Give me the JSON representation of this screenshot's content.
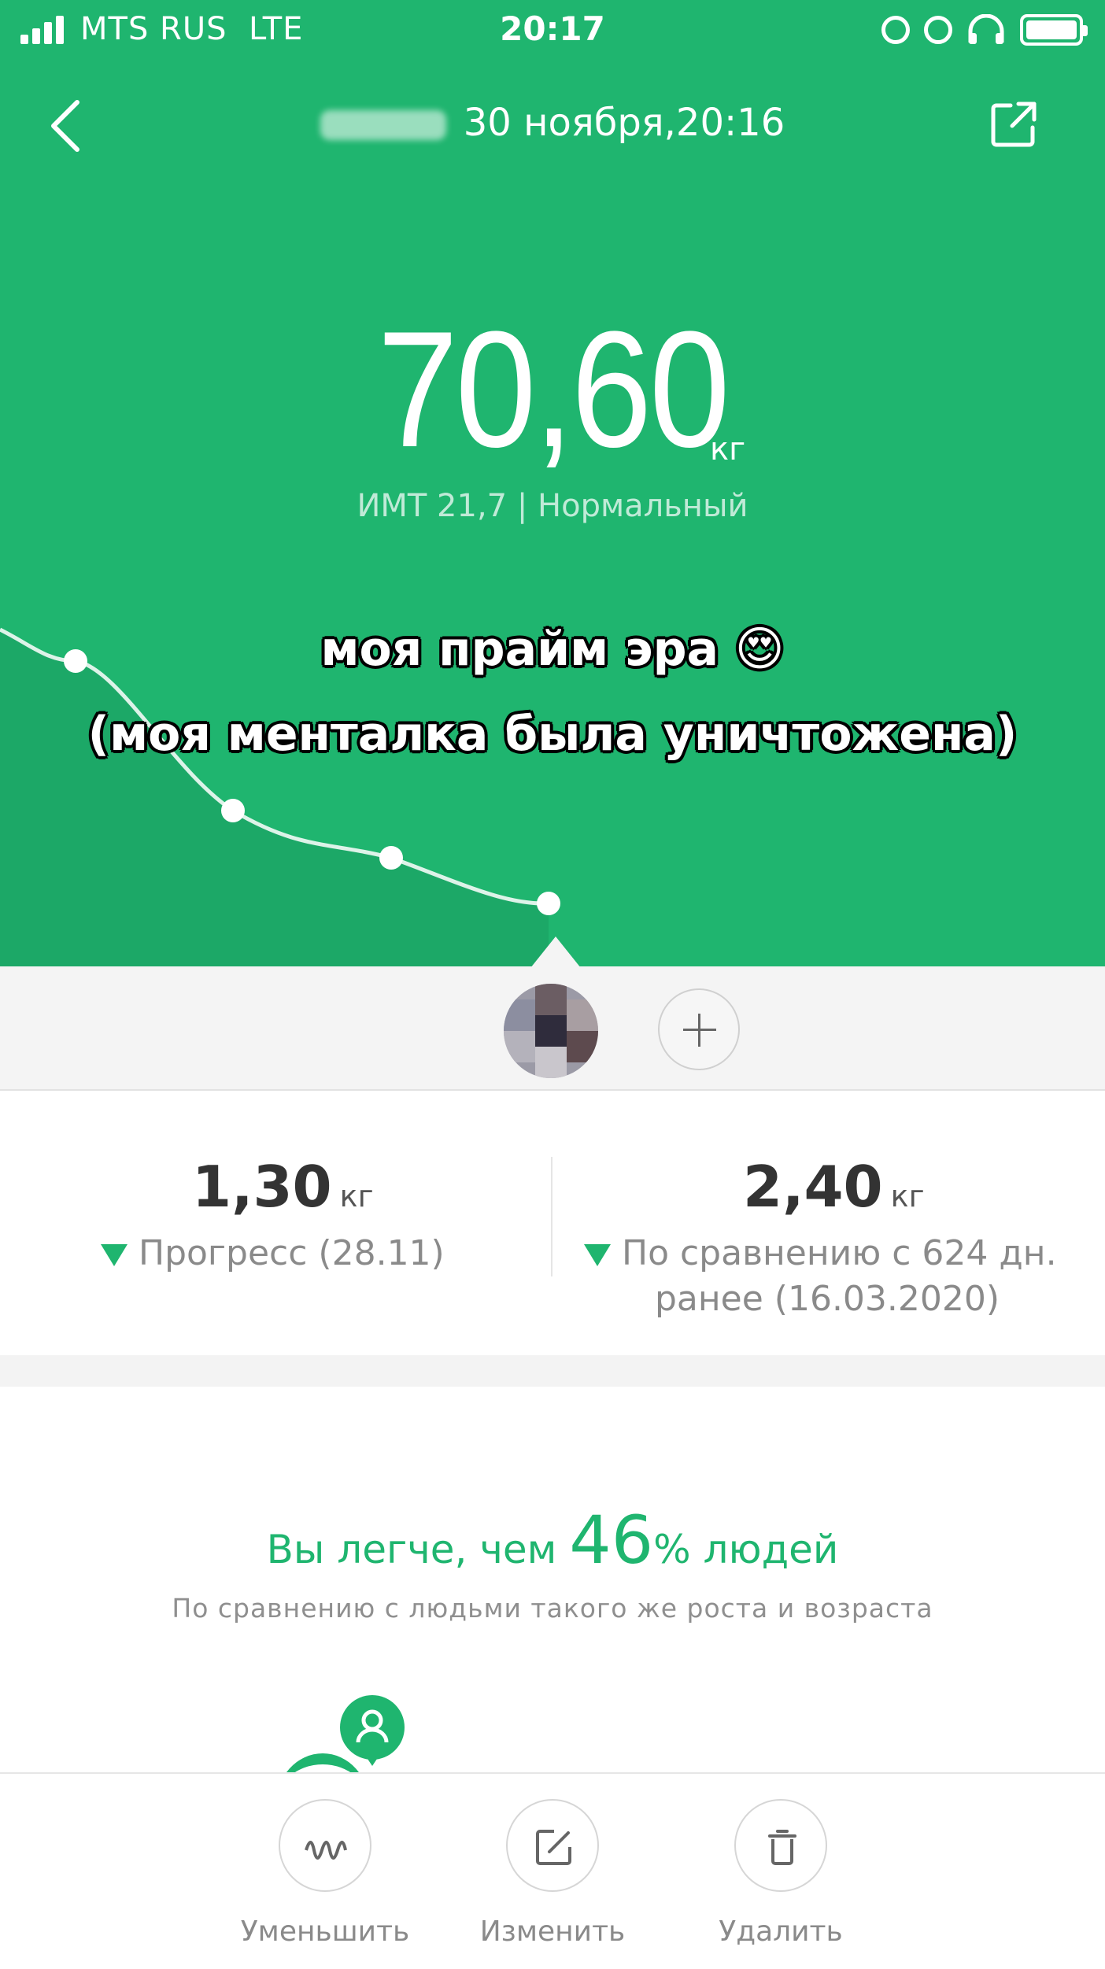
{
  "status_bar": {
    "carrier": "MTS RUS",
    "network": "LTE",
    "time": "20:17"
  },
  "header": {
    "title": "30 ноября,20:16"
  },
  "measurement": {
    "weight": "70,60",
    "unit": "кг",
    "bmi": "ИМТ 21,7 | Нормальный"
  },
  "caption": {
    "line1": "моя прайм эра 😍",
    "line2": "(моя менталка была уничтожена)"
  },
  "stats": {
    "left": {
      "value": "1,30",
      "unit": "кг",
      "label": "Прогресс (28.11)"
    },
    "right": {
      "value": "2,40",
      "unit": "кг",
      "label_line1": "По сравнению с 624 дн.",
      "label_line2": "ранее (16.03.2020)"
    }
  },
  "comparison": {
    "prefix": "Вы легче, чем ",
    "percent": "46",
    "suffix": "% людей",
    "subtitle": "По сравнению с людьми такого же роста и возраста"
  },
  "actions": [
    {
      "label": "Уменьшить"
    },
    {
      "label": "Изменить"
    },
    {
      "label": "Удалить"
    }
  ],
  "colors": {
    "brand": "#1fb56f",
    "background": "#ffffff",
    "strip": "#f4f4f4"
  },
  "icons": [
    "signal-icon",
    "orientation-lock-icon",
    "alarm-icon",
    "headphones-icon",
    "battery-icon",
    "back-icon",
    "share-icon",
    "plus-icon",
    "wave-icon",
    "edit-icon",
    "trash-icon",
    "person-icon"
  ]
}
